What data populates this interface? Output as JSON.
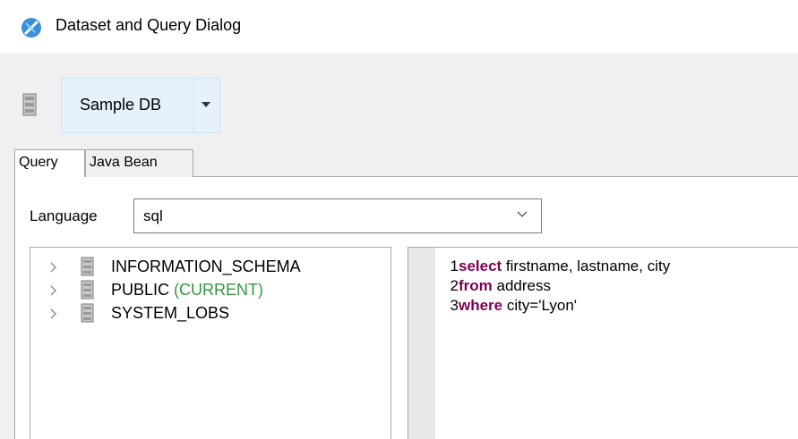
{
  "window": {
    "title": "Dataset and Query Dialog",
    "icon": "dialog-icon"
  },
  "datasource": {
    "label": "Sample DB",
    "icon": "database-icon",
    "dropdown_icon": "dropdown-arrow-icon"
  },
  "tabs": [
    {
      "label": "Query",
      "selected": true
    },
    {
      "label": "Java Bean",
      "selected": false
    }
  ],
  "language": {
    "label": "Language",
    "value": "sql"
  },
  "schemas": [
    {
      "name": "INFORMATION_SCHEMA",
      "suffix": ""
    },
    {
      "name": "PUBLIC",
      "suffix": "(CURRENT)"
    },
    {
      "name": "SYSTEM_LOBS",
      "suffix": ""
    }
  ],
  "editor": {
    "lines": [
      {
        "number": "1",
        "keyword": "select",
        "rest": " firstname, lastname, city"
      },
      {
        "number": "2",
        "keyword": "from",
        "rest": " address"
      },
      {
        "number": "3",
        "keyword": "where",
        "rest": " city='Lyon'"
      }
    ]
  },
  "colors": {
    "keyword": "#7f0055",
    "current_schema": "#2e9a3e",
    "selected_button": "#e5f1fb"
  }
}
